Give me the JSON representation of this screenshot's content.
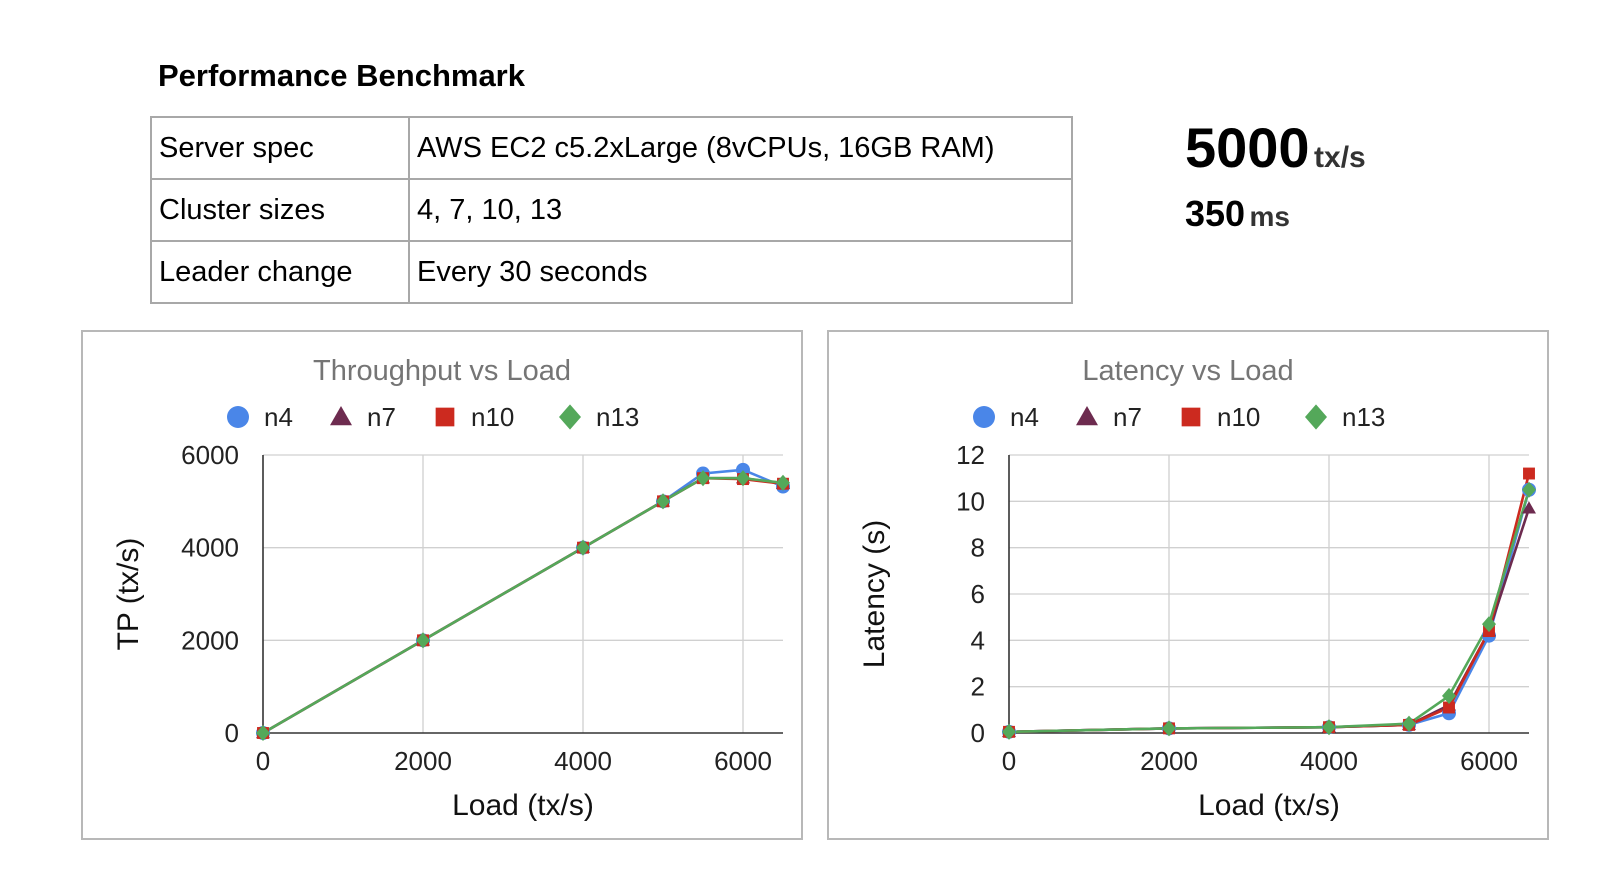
{
  "page": {
    "title": "Performance Benchmark",
    "spec_table": [
      {
        "key": "Server spec",
        "value": "AWS EC2 c5.2xLarge (8vCPUs, 16GB RAM)"
      },
      {
        "key": "Cluster sizes",
        "value": "4, 7, 10, 13"
      },
      {
        "key": "Leader change",
        "value": "Every 30 seconds"
      }
    ],
    "stats": {
      "throughput": {
        "value": "5000",
        "unit": "tx/s"
      },
      "latency": {
        "value": "350",
        "unit": "ms"
      }
    }
  },
  "chart_data": [
    {
      "type": "line",
      "title": "Throughput vs Load",
      "xlabel": "Load (tx/s)",
      "ylabel": "TP (tx/s)",
      "xlim": [
        0,
        6500
      ],
      "ylim": [
        0,
        6000
      ],
      "xticks": [
        0,
        2000,
        4000,
        6000
      ],
      "yticks": [
        0,
        2000,
        4000,
        6000
      ],
      "grid": true,
      "legend": "top",
      "x": [
        0,
        2000,
        4000,
        5000,
        5500,
        6000,
        6500
      ],
      "series": [
        {
          "name": "n4",
          "marker": "circle",
          "color": "#4a86e8",
          "values": [
            0,
            2000,
            4000,
            5000,
            5600,
            5680,
            5320
          ]
        },
        {
          "name": "n7",
          "marker": "triangle",
          "color": "#6d2b4f",
          "values": [
            0,
            2000,
            4000,
            5000,
            5500,
            5500,
            5380
          ]
        },
        {
          "name": "n10",
          "marker": "square",
          "color": "#cc2a1f",
          "values": [
            0,
            2000,
            4000,
            5000,
            5500,
            5480,
            5380
          ]
        },
        {
          "name": "n13",
          "marker": "diamond",
          "color": "#54a85a",
          "values": [
            0,
            2000,
            4000,
            5000,
            5500,
            5500,
            5400
          ]
        }
      ]
    },
    {
      "type": "line",
      "title": "Latency vs Load",
      "xlabel": "Load (tx/s)",
      "ylabel": "Latency (s)",
      "xlim": [
        0,
        6500
      ],
      "ylim": [
        0,
        12
      ],
      "xticks": [
        0,
        2000,
        4000,
        6000
      ],
      "yticks": [
        0,
        2,
        4,
        6,
        8,
        10,
        12
      ],
      "grid": true,
      "legend": "top",
      "x": [
        0,
        2000,
        4000,
        5000,
        5500,
        6000,
        6500
      ],
      "series": [
        {
          "name": "n4",
          "marker": "circle",
          "color": "#4a86e8",
          "values": [
            0.05,
            0.2,
            0.25,
            0.35,
            0.85,
            4.2,
            10.5
          ]
        },
        {
          "name": "n7",
          "marker": "triangle",
          "color": "#6d2b4f",
          "values": [
            0.05,
            0.2,
            0.25,
            0.35,
            1.2,
            4.4,
            9.7
          ]
        },
        {
          "name": "n10",
          "marker": "square",
          "color": "#cc2a1f",
          "values": [
            0.05,
            0.2,
            0.25,
            0.35,
            1.1,
            4.4,
            11.2
          ]
        },
        {
          "name": "n13",
          "marker": "diamond",
          "color": "#54a85a",
          "values": [
            0.05,
            0.2,
            0.25,
            0.4,
            1.6,
            4.7,
            10.5
          ]
        }
      ]
    }
  ]
}
